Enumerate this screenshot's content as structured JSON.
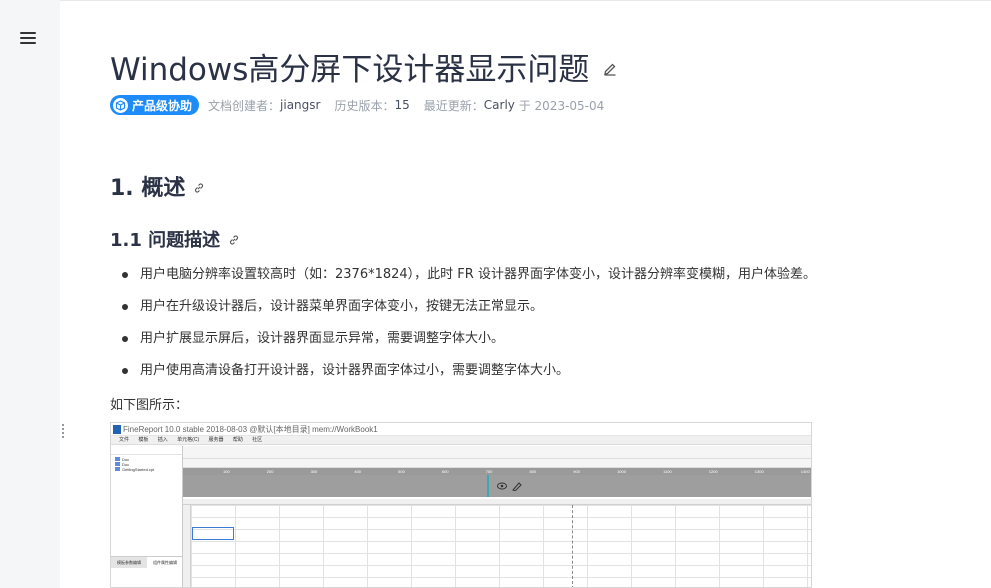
{
  "sidebar": {
    "menu_icon": "hamburger-menu-icon"
  },
  "title": "Windows高分屏下设计器显示问题",
  "meta": {
    "badge": "产品级协助",
    "creator_label": "文档创建者：",
    "creator": "jiangsr",
    "history_label": "历史版本：",
    "history": "15",
    "updated_label": "最近更新：",
    "updated_by": "Carly",
    "updated_on": "于 2023-05-04"
  },
  "section": {
    "h1": "1. 概述",
    "h2": "1.1 问题描述"
  },
  "bullets": [
    "用户电脑分辨率设置较高时（如：2376*1824），此时 FR 设计器界面字体变小，设计器分辨率变模糊，用户体验差。",
    "用户在升级设计器后，设计器菜单界面字体变小，按键无法正常显示。",
    "用户扩展显示屏后，设计器界面显示异常，需要调整字体大小。",
    "用户使用高清设备打开设计器，设计器界面字体过小，需要调整字体大小。"
  ],
  "paragraph": "如下图所示：",
  "screenshot": {
    "window_title": "FineReport 10.0 stable 2018-08-03 @默认[本地目录]    mem://WorkBook1",
    "menu": "文件 模板 插入 单元格(C) 服务器 帮助 社区",
    "tree": [
      "Doc",
      "Doc",
      "GettingStarted.cpt"
    ],
    "tabs": [
      "模板参数编辑",
      "组件属性编辑"
    ],
    "ruler": "100 200 300 400 500 600 700 800 900 1000 1100 1200 1300 1400 1500 1600 1700 1800 1900"
  },
  "colors": {
    "accent": "#1d8cf8",
    "title": "#2b3245"
  }
}
